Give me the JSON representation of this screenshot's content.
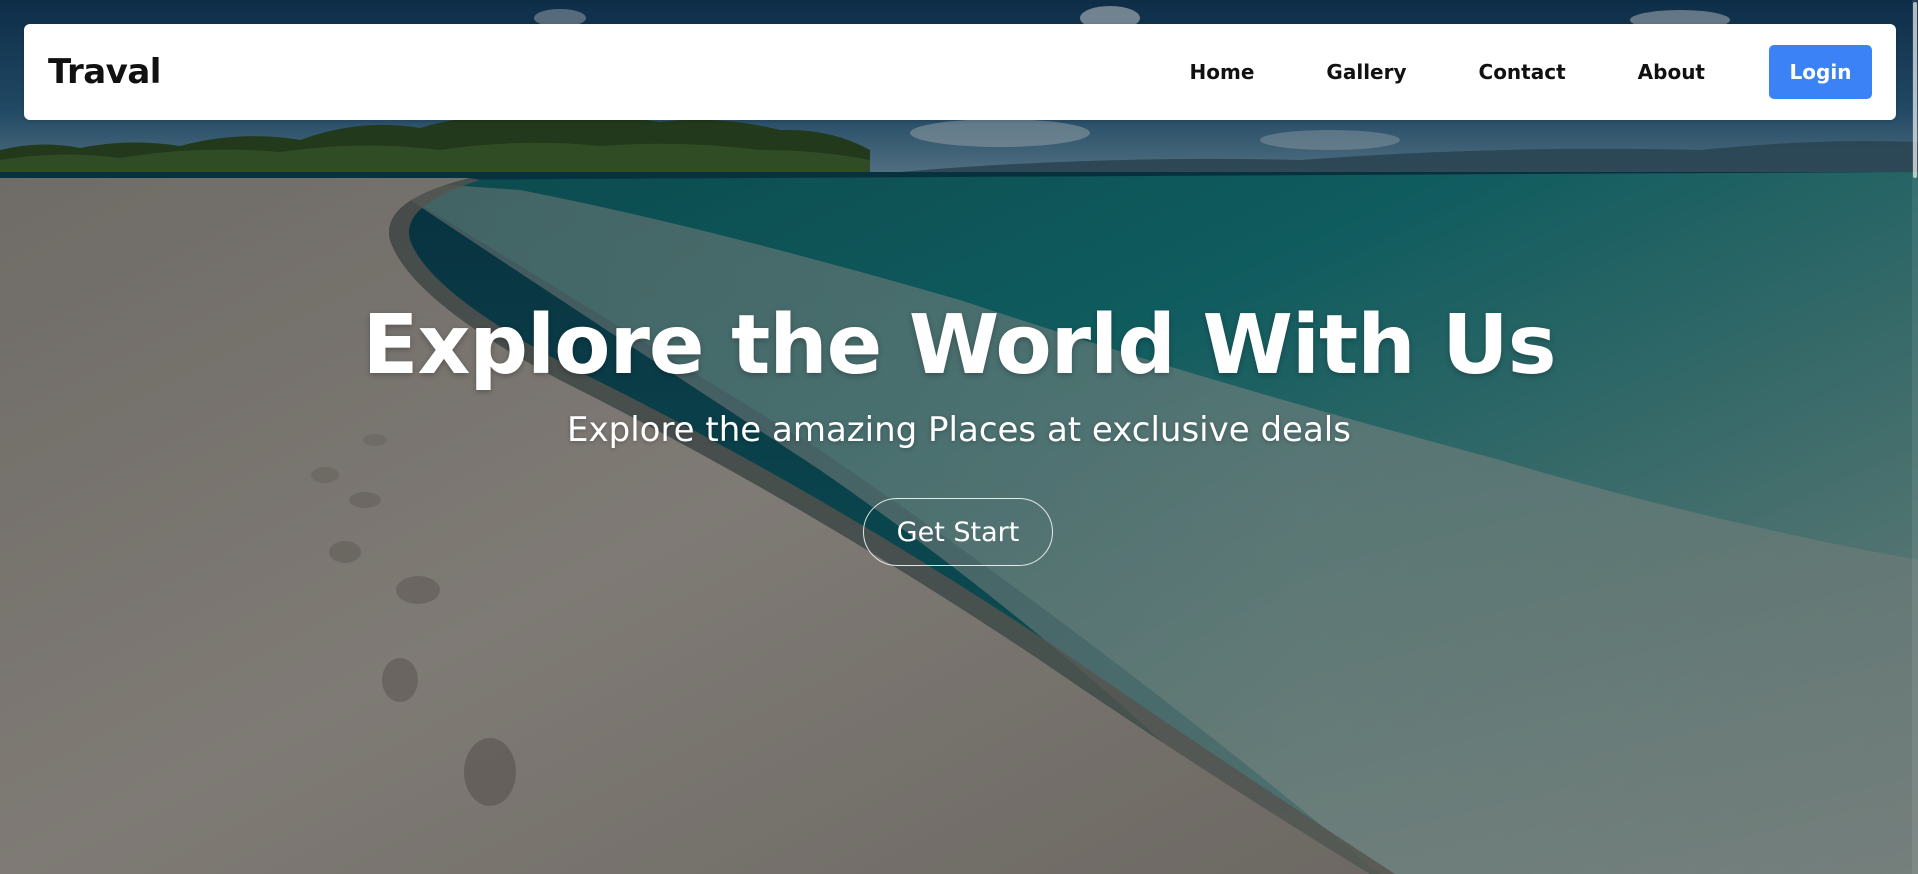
{
  "brand": {
    "name": "Traval"
  },
  "nav": {
    "items": [
      {
        "label": "Home"
      },
      {
        "label": "Gallery"
      },
      {
        "label": "Contact"
      },
      {
        "label": "About"
      }
    ],
    "login_label": "Login"
  },
  "hero": {
    "title": "Explore the World With Us",
    "subtitle": "Explore the amazing Places at exclusive deals",
    "cta_label": "Get Start",
    "background": "beach-shoreline-photo"
  },
  "colors": {
    "login_button": "#3b82f6",
    "navbar_background": "#ffffff",
    "hero_text": "#ffffff"
  }
}
